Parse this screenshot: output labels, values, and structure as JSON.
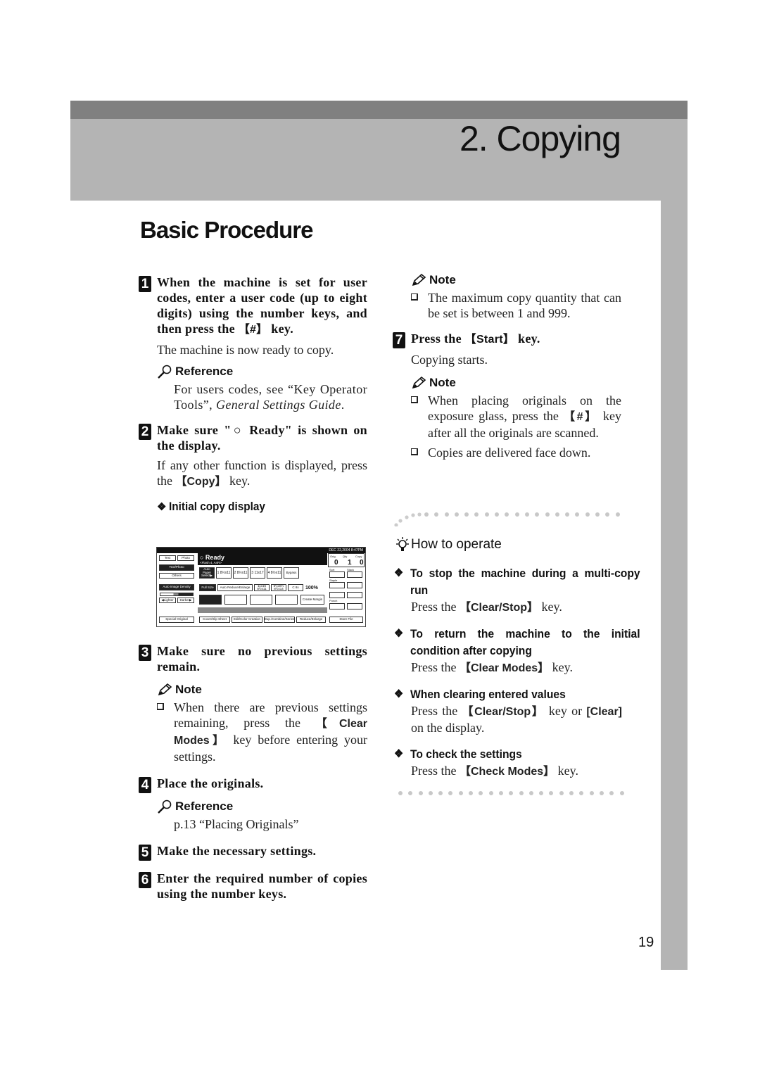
{
  "chapter": {
    "title": "2. Copying"
  },
  "section": {
    "title": "Basic Procedure"
  },
  "steps": [
    {
      "num": "1",
      "title_pre": "When the machine is set for user codes, enter a user code (up to eight digits) using the number keys, and then press the ",
      "title_key": "【#】",
      "title_post": " key.",
      "body": "The machine is now ready to copy."
    },
    {
      "num": "2",
      "title": "Make sure \"○ Ready\" is shown on the display.",
      "body_pre": "If any other function is displayed, press the ",
      "body_key": "【Copy】",
      "body_post": " key."
    },
    {
      "num": "3",
      "title": "Make sure no previous settings remain."
    },
    {
      "num": "4",
      "title": "Place the originals."
    },
    {
      "num": "5",
      "title": "Make the necessary settings."
    },
    {
      "num": "6",
      "title": "Enter the required number of copies using the number keys."
    },
    {
      "num": "7",
      "title_pre": "Press the ",
      "title_key": "【Start】",
      "title_post": " key.",
      "body": "Copying starts."
    }
  ],
  "reference1": {
    "label": "Reference",
    "text_pre": "For users codes, see “Key Operator Tools”, ",
    "text_italic": "General Settings Guide",
    "text_post": "."
  },
  "initial_display": {
    "label": "Initial copy display"
  },
  "panel": {
    "datetime": "DEC 22,2004 8:47PM",
    "status": "○ Ready",
    "status_sub": "<Flash 4, A4R>",
    "left_buttons": [
      "Text",
      "Photo",
      "Text/Photo",
      "Others",
      "Auto Image Density",
      "◀Lighter",
      "Darker▶",
      "Special Original"
    ],
    "paper_buttons": [
      "Auto Paper Select▶",
      "1 8½x11",
      "2 8½x11",
      "3 11x17",
      "4 8½x11",
      "Bypass"
    ],
    "ratio_buttons": [
      "Full Size",
      "Auto Reduce/Enlarge",
      "11x15 8½x11",
      "5½x8½ 8½x14",
      "C 8x"
    ],
    "ratio_value": "100%",
    "function_buttons": [
      "Create Margin"
    ],
    "bottom_tabs": [
      "Cover/Slip Sheet",
      "Edit/Color Creation",
      "Dup./Combine/Series",
      "Reduce/Enlarge",
      "Store File"
    ],
    "counter": {
      "orig_label": "Orig.",
      "qty_label": "Qty",
      "copy_label": "Copy",
      "orig": "0",
      "qty": "1",
      "copy": "0"
    },
    "right_labels": [
      "Sort",
      "Stack",
      "Staple",
      "Punch"
    ]
  },
  "note_step3": {
    "label": "Note",
    "text_pre": "When there are previous settings remaining, press the ",
    "key": "【Clear Modes】",
    "text_post": " key before entering your settings."
  },
  "reference4": {
    "label": "Reference",
    "text": "p.13 “Placing Originals”"
  },
  "note_step6": {
    "label": "Note",
    "text": "The maximum copy quantity that can be set is between 1 and 999."
  },
  "note_step7": {
    "label": "Note",
    "item1_pre": "When placing originals on the exposure glass, press the ",
    "item1_key": "【#】",
    "item1_post": " key after all the originals are scanned.",
    "item2": "Copies are delivered face down."
  },
  "how_to_operate": {
    "label": "How to operate",
    "items": [
      {
        "head": "To stop the machine during a multi-copy run",
        "pre": "Press the ",
        "key": "【Clear/Stop】",
        "post": " key."
      },
      {
        "head": "To return the machine to the initial condition after copying",
        "pre": "Press the ",
        "key": "【Clear Modes】",
        "post": " key."
      },
      {
        "head": "When clearing entered values",
        "pre": "Press the ",
        "key": "【Clear/Stop】",
        "mid": " key or ",
        "key2": "[Clear]",
        "post": " on the display."
      },
      {
        "head": "To check the settings",
        "pre": "Press the ",
        "key": "【Check Modes】",
        "post": " key."
      }
    ]
  },
  "page_number": "19"
}
